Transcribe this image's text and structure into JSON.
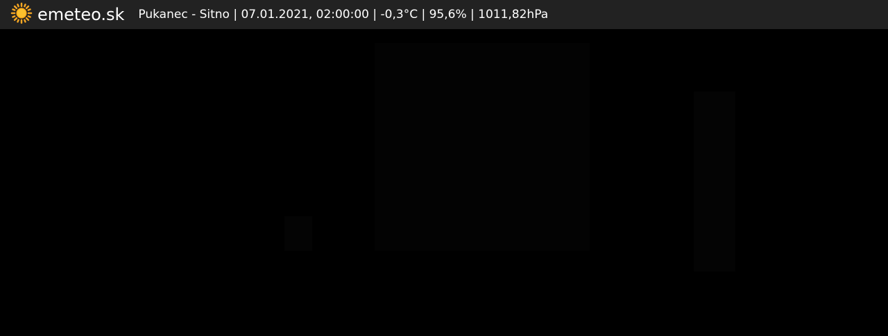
{
  "brand": {
    "icon": "sun-icon",
    "name": "emeteo.sk",
    "icon_color": "#f5a623"
  },
  "caption": {
    "text": "Pukanec - Sitno | 07.01.2021, 02:00:00 | -0,3°C | 95,6% | 1011,82hPa"
  },
  "colors": {
    "topbar_background": "#222222",
    "camera_background": "#000000",
    "text": "#ffffff"
  }
}
